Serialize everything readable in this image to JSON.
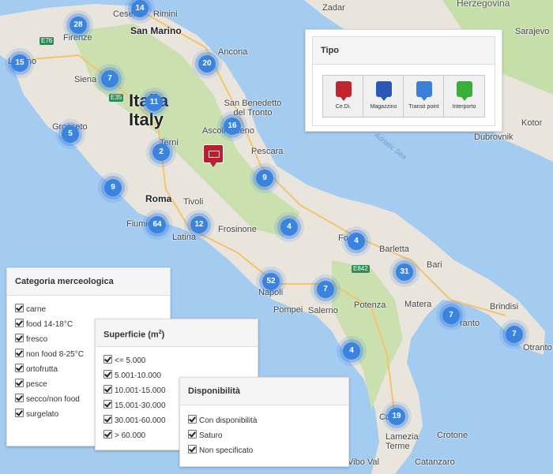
{
  "map": {
    "title": "Italia Italy",
    "places": [
      {
        "id": "zadar",
        "label": "Zadar"
      },
      {
        "id": "hercegovina",
        "label": "Herzegovina"
      },
      {
        "id": "sarajevo",
        "label": "Sarajevo"
      },
      {
        "id": "cesena",
        "label": "Cesena"
      },
      {
        "id": "rimini",
        "label": "Rimini"
      },
      {
        "id": "san-marino",
        "label": "San Marino"
      },
      {
        "id": "firenze",
        "label": "Firenze"
      },
      {
        "id": "livorno",
        "label": "Livorno"
      },
      {
        "id": "ancona",
        "label": "Ancona"
      },
      {
        "id": "siena",
        "label": "Siena"
      },
      {
        "id": "san-benedetto",
        "label": "San Benedetto del Tronto"
      },
      {
        "id": "grosseto",
        "label": "Grosseto"
      },
      {
        "id": "ascoli",
        "label": "Ascoli Piceno"
      },
      {
        "id": "terni",
        "label": "Terni"
      },
      {
        "id": "pescara",
        "label": "Pescara"
      },
      {
        "id": "kotor",
        "label": "Kotor"
      },
      {
        "id": "dubrovnik",
        "label": "Dubrovnik"
      },
      {
        "id": "adriatic",
        "label": "Adriatic Sea"
      },
      {
        "id": "roma",
        "label": "Roma"
      },
      {
        "id": "tivoli",
        "label": "Tivoli"
      },
      {
        "id": "fiumicino",
        "label": "Fiumicino"
      },
      {
        "id": "latina",
        "label": "Latina"
      },
      {
        "id": "frosinone",
        "label": "Frosinone"
      },
      {
        "id": "foggia",
        "label": "Fo"
      },
      {
        "id": "barletta",
        "label": "Barletta"
      },
      {
        "id": "bari",
        "label": "Bari"
      },
      {
        "id": "napoli",
        "label": "Napoli"
      },
      {
        "id": "pompei",
        "label": "Pompei"
      },
      {
        "id": "salerno",
        "label": "Salerno"
      },
      {
        "id": "potenza",
        "label": "Potenza"
      },
      {
        "id": "matera",
        "label": "Matera"
      },
      {
        "id": "brindisi",
        "label": "Brindisi"
      },
      {
        "id": "taranto",
        "label": "ranto"
      },
      {
        "id": "otranto",
        "label": "Otranto"
      },
      {
        "id": "cosenza",
        "label": "Co za"
      },
      {
        "id": "crotone",
        "label": "Crotone"
      },
      {
        "id": "lamezia",
        "label": "Lamezia Terme"
      },
      {
        "id": "vibo",
        "label": "Vibo Val"
      },
      {
        "id": "catanzaro",
        "label": "Catanzaro"
      }
    ],
    "road_shields": [
      "E76",
      "E35",
      "E842"
    ],
    "clusters": [
      {
        "count": "14"
      },
      {
        "count": "28"
      },
      {
        "count": "15"
      },
      {
        "count": "20"
      },
      {
        "count": "7"
      },
      {
        "count": "11"
      },
      {
        "count": "16"
      },
      {
        "count": "5"
      },
      {
        "count": "2"
      },
      {
        "count": "9"
      },
      {
        "count": "9"
      },
      {
        "count": "64"
      },
      {
        "count": "12"
      },
      {
        "count": "4"
      },
      {
        "count": "4"
      },
      {
        "count": "31"
      },
      {
        "count": "52"
      },
      {
        "count": "7"
      },
      {
        "count": "7"
      },
      {
        "count": "7"
      },
      {
        "count": "4"
      },
      {
        "count": "19"
      }
    ],
    "colors": {
      "sea": "#a4cbf0",
      "land": "#e9e5dc",
      "green": "#c6dfaa",
      "cluster": "#3a84e0",
      "pin": "#b5212e"
    }
  },
  "tipo": {
    "title": "Tipo",
    "buttons": [
      {
        "label": "Ce.Di.",
        "color": "#c0252f",
        "icon": "warehouse-icon"
      },
      {
        "label": "Magazzino",
        "color": "#2b58b5",
        "icon": "warehouse-icon"
      },
      {
        "label": "Transit point",
        "color": "#3a7fd8",
        "icon": "arrows-icon"
      },
      {
        "label": "Interporto",
        "color": "#3aae3a",
        "icon": "train-icon"
      }
    ]
  },
  "categoria": {
    "title": "Categoria merceologica",
    "items": [
      "carne",
      "food 14-18°C",
      "fresco",
      "non food 8-25°C",
      "ortofrutta",
      "pesce",
      "secco/non food",
      "surgelato"
    ]
  },
  "superficie": {
    "title": "Superficie (m",
    "title_sup": "2",
    "title_end": ")",
    "items": [
      "<= 5.000",
      "5.001-10.000",
      "10.001-15.000",
      "15.001-30.000",
      "30.001-60.000",
      "> 60.000"
    ]
  },
  "disponibilita": {
    "title": "Disponibilità",
    "items": [
      "Con disponibilità",
      "Saturo",
      "Non specificato"
    ]
  }
}
